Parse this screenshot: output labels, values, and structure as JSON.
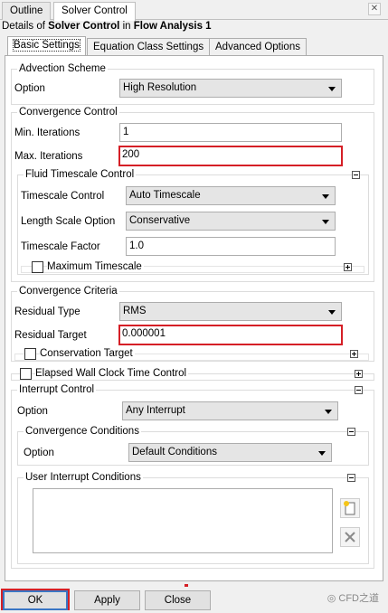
{
  "window": {
    "tabs": [
      "Outline",
      "Solver Control"
    ],
    "active_tab": "Solver Control",
    "close_icon": "close-icon"
  },
  "details": {
    "prefix": "Details of ",
    "object": "Solver Control",
    "middle": " in ",
    "parent": "Flow Analysis 1"
  },
  "inner_tabs": [
    "Basic Settings",
    "Equation Class Settings",
    "Advanced Options"
  ],
  "advection": {
    "title": "Advection Scheme",
    "option_label": "Option",
    "option_value": "High Resolution"
  },
  "convergence_control": {
    "title": "Convergence Control",
    "min_iter_label": "Min. Iterations",
    "min_iter_value": "1",
    "max_iter_label": "Max. Iterations",
    "max_iter_value": "200",
    "fluid_timescale": {
      "title": "Fluid Timescale Control",
      "timescale_control_label": "Timescale Control",
      "timescale_control_value": "Auto Timescale",
      "length_scale_label": "Length Scale Option",
      "length_scale_value": "Conservative",
      "timescale_factor_label": "Timescale Factor",
      "timescale_factor_value": "1.0",
      "max_timescale_label": "Maximum Timescale"
    }
  },
  "convergence_criteria": {
    "title": "Convergence Criteria",
    "residual_type_label": "Residual Type",
    "residual_type_value": "RMS",
    "residual_target_label": "Residual Target",
    "residual_target_value": "0.000001",
    "conservation_target_label": "Conservation Target"
  },
  "elapsed_wall_clock": {
    "label": "Elapsed Wall Clock Time Control"
  },
  "interrupt_control": {
    "title": "Interrupt Control",
    "option_label": "Option",
    "option_value": "Any Interrupt",
    "convergence_conditions": {
      "title": "Convergence Conditions",
      "option_label": "Option",
      "option_value": "Default Conditions"
    },
    "user_interrupt": {
      "title": "User Interrupt Conditions"
    }
  },
  "buttons": {
    "ok": "OK",
    "apply": "Apply",
    "close": "Close"
  },
  "watermark": "CFD之道",
  "colors": {
    "highlight_red": "#d51f26",
    "default_button_blue": "#3a76c4"
  }
}
